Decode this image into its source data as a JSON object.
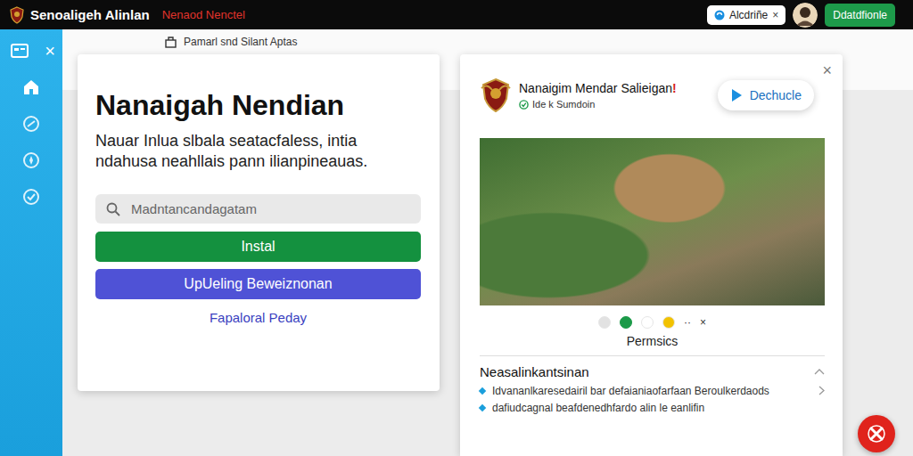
{
  "top_bar": {
    "brand": "Senoaligeh Alinlan",
    "tagline": "Nenaod Nenctel",
    "account_chip": "Alcdriñe",
    "account_chip_close": "×",
    "action_button": "Ddatdfionle"
  },
  "sidebar": {
    "close": "×",
    "items": [
      {
        "selected": true
      },
      {
        "selected": false
      },
      {
        "selected": false
      },
      {
        "selected": false
      }
    ]
  },
  "breadcrumb": "Pamarl snd Silant Aptas",
  "left_card": {
    "title": "Nanaigah Nendian",
    "description": "Nauar Inlua slbala seatacfaless, intia ndahusa neahllais pann ilianpineauas.",
    "search": {
      "placeholder": "Madntancandagatam"
    },
    "primary_button": "Instal",
    "secondary_button": "UpUeling Beweiznonan",
    "link": "Fapaloral Peday"
  },
  "right_card": {
    "close": "×",
    "title": "Nanaigim Mendar Salieigan",
    "alert": "!",
    "subtitle": "Ide k Sumdoin",
    "action": "Dechucle",
    "dots": [
      {
        "color": "#e2e2e2",
        "selected": false
      },
      {
        "color": "#1b9a48",
        "selected": true
      },
      {
        "color": "#ffffff",
        "selected": false
      },
      {
        "color": "#f2c200",
        "selected": false
      }
    ],
    "dot_more": "··",
    "dot_close": "×",
    "caption": "Permsics",
    "section": {
      "title": "Neasalinkantsinan",
      "expanded": true,
      "items": [
        "Idvananlkaresedairil bar defaianiaofarfaan Beroulkerdaods",
        "dafiudcagnal beafdenedhfardo alin le eanlifin"
      ]
    }
  }
}
